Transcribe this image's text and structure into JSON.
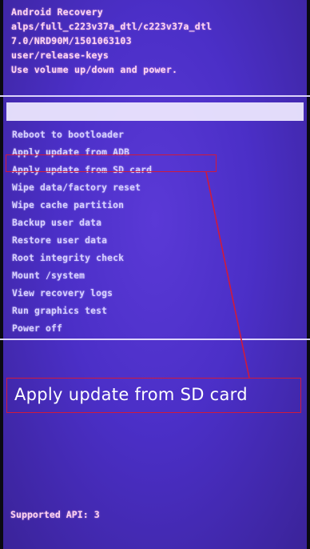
{
  "header": {
    "lines": [
      "Android Recovery",
      "alps/full_c223v37a_dtl/c223v37a_dtl",
      "7.0/NRD90M/1501063103",
      "user/release-keys",
      "Use volume up/down and power."
    ]
  },
  "menu": {
    "items": [
      "Reboot to bootloader",
      "Apply update from ADB",
      "Apply update from SD card",
      "Wipe data/factory reset",
      "Wipe cache partition",
      "Backup user data",
      "Restore user data",
      "Root integrity check",
      "Mount /system",
      "View recovery logs",
      "Run graphics test",
      "Power off"
    ],
    "selected_index": 0,
    "annotated_index": 2
  },
  "annotation": {
    "label": "Apply update from SD card"
  },
  "footer": {
    "text": "Supported API: 3"
  },
  "colors": {
    "background": "#4b2fc7",
    "header_text": "#ffd4f2",
    "menu_text": "#d7d1ff",
    "highlight": "#efe9ff",
    "annotation": "#d01a3c"
  }
}
